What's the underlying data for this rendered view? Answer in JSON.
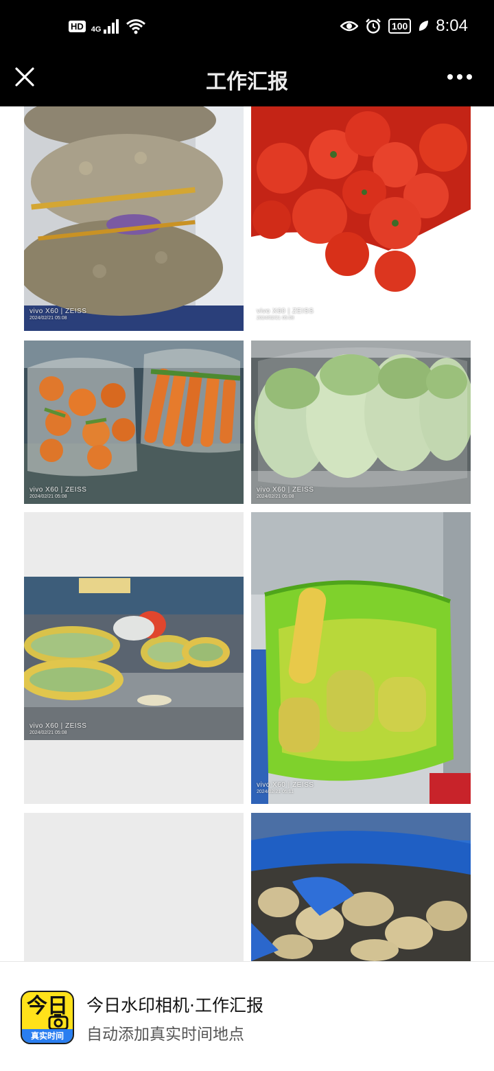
{
  "status_bar": {
    "hd_badge": "HD",
    "network": "4G",
    "battery": "100",
    "time": "8:04"
  },
  "nav": {
    "title": "工作汇报",
    "close_icon": "close-icon",
    "more_icon": "more-dots-icon"
  },
  "photos": [
    {
      "subject": "potatoes in mesh sacks",
      "brand": "vivo X60 | ZEISS",
      "date": "2024/02/21 05:08"
    },
    {
      "subject": "tomatoes in white bag",
      "brand": "vivo X60 | ZEISS",
      "date": "2024/02/21 05:08"
    },
    {
      "subject": "carrots in plastic bags",
      "brand": "vivo X60 | ZEISS",
      "date": "2024/02/21 05:08"
    },
    {
      "subject": "napa cabbage wrapped in film",
      "brand": "vivo X60 | ZEISS",
      "date": "2024/02/21 05:08"
    },
    {
      "subject": "bagged greens on steel counter",
      "brand": "vivo X60 | ZEISS",
      "date": "2024/02/21 05:08"
    },
    {
      "subject": "corn in green bag",
      "brand": "vivo X60 | ZEISS",
      "date": "2024/02/21 05:11"
    },
    {
      "subject": "blank tile"
    },
    {
      "subject": "ginger in blue bag"
    }
  ],
  "banner": {
    "title": "今日水印相机·工作汇报",
    "subtitle": "自动添加真实时间地点",
    "icon_top_text": "今日",
    "icon_strip_text": "真实时间"
  },
  "colors": {
    "bar_bg": "#000000",
    "app_icon_yellow": "#ffe21a",
    "app_icon_blue": "#2a7ef0"
  }
}
